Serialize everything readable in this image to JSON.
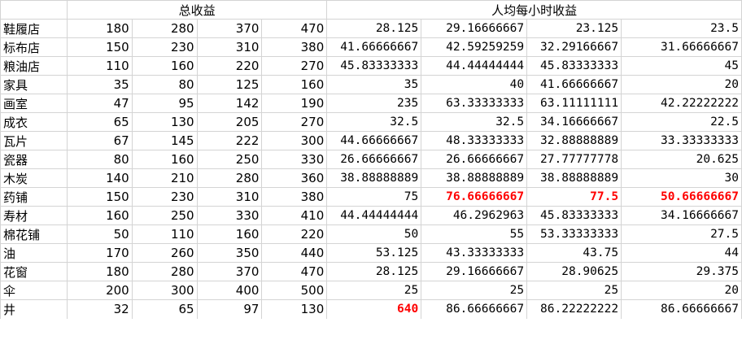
{
  "header": {
    "total_income": "总收益",
    "hourly_income": "人均每小时收益"
  },
  "rows": [
    {
      "name": "鞋履店",
      "totals": [
        "180",
        "280",
        "370",
        "470"
      ],
      "hourly": [
        "28.125",
        "29.16666667",
        "23.125",
        "23.5"
      ]
    },
    {
      "name": "标布店",
      "totals": [
        "150",
        "230",
        "310",
        "380"
      ],
      "hourly": [
        "41.66666667",
        "42.59259259",
        "32.29166667",
        "31.66666667"
      ]
    },
    {
      "name": "粮油店",
      "totals": [
        "110",
        "160",
        "220",
        "270"
      ],
      "hourly": [
        "45.83333333",
        "44.44444444",
        "45.83333333",
        "45"
      ]
    },
    {
      "name": "家具",
      "totals": [
        "35",
        "80",
        "125",
        "160"
      ],
      "hourly": [
        "35",
        "40",
        "41.66666667",
        "20"
      ]
    },
    {
      "name": "画室",
      "totals": [
        "47",
        "95",
        "142",
        "190"
      ],
      "hourly": [
        "235",
        "63.33333333",
        "63.11111111",
        "42.22222222"
      ]
    },
    {
      "name": "成衣",
      "totals": [
        "65",
        "130",
        "205",
        "270"
      ],
      "hourly": [
        "32.5",
        "32.5",
        "34.16666667",
        "22.5"
      ]
    },
    {
      "name": "瓦片",
      "totals": [
        "67",
        "145",
        "222",
        "300"
      ],
      "hourly": [
        "44.66666667",
        "48.33333333",
        "32.88888889",
        "33.33333333"
      ]
    },
    {
      "name": "瓷器",
      "totals": [
        "80",
        "160",
        "250",
        "330"
      ],
      "hourly": [
        "26.66666667",
        "26.66666667",
        "27.77777778",
        "20.625"
      ]
    },
    {
      "name": "木炭",
      "totals": [
        "140",
        "210",
        "280",
        "360"
      ],
      "hourly": [
        "38.88888889",
        "38.88888889",
        "38.88888889",
        "30"
      ]
    },
    {
      "name": "药铺",
      "totals": [
        "150",
        "230",
        "310",
        "380"
      ],
      "hourly": [
        "75",
        "76.66666667",
        "77.5",
        "50.66666667"
      ],
      "highlight": [
        false,
        true,
        true,
        true
      ]
    },
    {
      "name": "寿材",
      "totals": [
        "160",
        "250",
        "330",
        "410"
      ],
      "hourly": [
        "44.44444444",
        "46.2962963",
        "45.83333333",
        "34.16666667"
      ]
    },
    {
      "name": "棉花铺",
      "totals": [
        "50",
        "110",
        "160",
        "220"
      ],
      "hourly": [
        "50",
        "55",
        "53.33333333",
        "27.5"
      ]
    },
    {
      "name": "油",
      "totals": [
        "170",
        "260",
        "350",
        "440"
      ],
      "hourly": [
        "53.125",
        "43.33333333",
        "43.75",
        "44"
      ]
    },
    {
      "name": "花窗",
      "totals": [
        "180",
        "280",
        "370",
        "470"
      ],
      "hourly": [
        "28.125",
        "29.16666667",
        "28.90625",
        "29.375"
      ]
    },
    {
      "name": "伞",
      "totals": [
        "200",
        "300",
        "400",
        "500"
      ],
      "hourly": [
        "25",
        "25",
        "25",
        "20"
      ]
    },
    {
      "name": "井",
      "totals": [
        "32",
        "65",
        "97",
        "130"
      ],
      "hourly": [
        "640",
        "86.66666667",
        "86.22222222",
        "86.66666667"
      ],
      "highlight": [
        true,
        false,
        false,
        false
      ]
    }
  ],
  "colors": {
    "gridline": "#d4d4d4",
    "highlight_text": "#ff0000"
  }
}
